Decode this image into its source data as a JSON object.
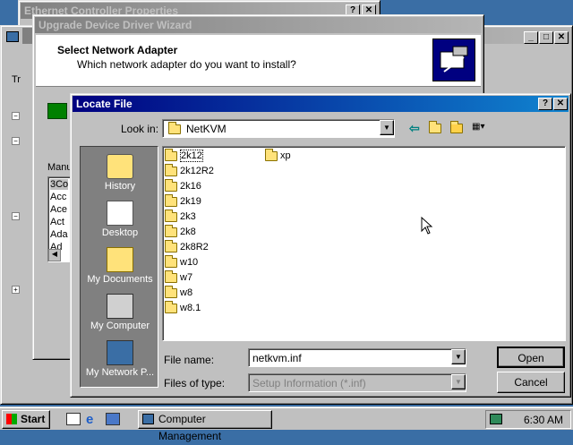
{
  "windows": {
    "ethernet": {
      "title": "Ethernet Controller Properties"
    },
    "computer_mgmt": {
      "title": "Computer Management",
      "tree_label": "Tr",
      "left_letters": "Manu"
    },
    "wizard": {
      "title": "Upgrade Device Driver Wizard",
      "heading": "Select Network Adapter",
      "subheading": "Which network adapter do you want to install?",
      "list_items": [
        "3Co",
        "Acc",
        "Ace",
        "Act",
        "Ada",
        "Ad"
      ]
    },
    "locate": {
      "title": "Locate File",
      "look_in_label": "Look in:",
      "look_in_value": "NetKVM",
      "places": [
        "History",
        "Desktop",
        "My Documents",
        "My Computer",
        "My Network P..."
      ],
      "folders_col1": [
        "2k12",
        "2k12R2",
        "2k16",
        "2k19",
        "2k3",
        "2k8",
        "2k8R2",
        "w10",
        "w7",
        "w8",
        "w8.1"
      ],
      "folders_col2": [
        "xp"
      ],
      "file_name_label": "File name:",
      "file_name_value": "netkvm.inf",
      "files_of_type_label": "Files of type:",
      "files_of_type_value": "Setup Information (*.inf)",
      "open_label": "Open",
      "cancel_label": "Cancel"
    }
  },
  "taskbar": {
    "start_label": "Start",
    "task_label": "Computer Management",
    "clock": "6:30 AM"
  },
  "colors": {
    "desktop": "#3a6ea5",
    "title_active": "#000080",
    "title_inactive": "#808080"
  }
}
